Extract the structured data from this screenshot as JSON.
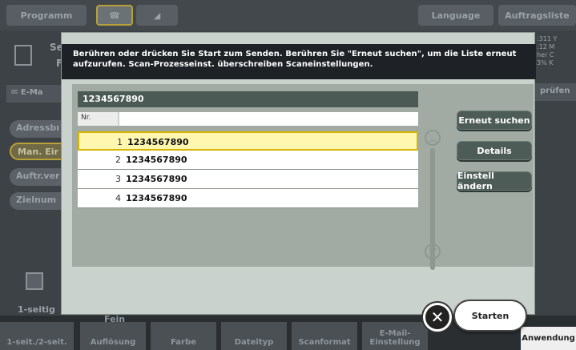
{
  "topbar": {
    "programm": "Programm",
    "language": "Language",
    "auftragsliste": "Auftragsliste"
  },
  "background": {
    "header_line1": "Se",
    "header_line2": "Fa",
    "email_tab": "E-Ma",
    "pills": [
      "Adressbı",
      "Man. Eir",
      "Auftr.ver",
      "Zielnum"
    ],
    "meter_lines": [
      ":311 Y",
      ":12 M",
      "her C",
      "3% K"
    ],
    "pruefen": "prüfen",
    "single_label": "1-seitig"
  },
  "bottom_tabs": {
    "fein": "Fein",
    "tabs": [
      "1-seit./2-seit.",
      "Auflösung",
      "Farbe",
      "Dateityp",
      "Scanformat",
      "E-Mail-\nEinstellung"
    ],
    "anwendung": "Anwendung"
  },
  "modal": {
    "message": "Berühren oder drücken Sie Start zum Senden. Berühren Sie \"Erneut suchen\", um die Liste erneut aufzurufen. Scan-Prozesseinst. überschreiben Scaneinstellungen.",
    "list_title": "1234567890",
    "col_nr": "Nr.",
    "rows": [
      {
        "nr": "1",
        "number": "1234567890",
        "selected": true
      },
      {
        "nr": "2",
        "number": "1234567890",
        "selected": false
      },
      {
        "nr": "3",
        "number": "1234567890",
        "selected": false
      },
      {
        "nr": "4",
        "number": "1234567890",
        "selected": false
      }
    ],
    "buttons": {
      "erneut": "Erneut suchen",
      "details": "Details",
      "einstell": "Einstell ändern"
    }
  },
  "actions": {
    "start": "Starten",
    "cancel_icon": "close-icon"
  },
  "colors": {
    "accent_selected": "#d6b400",
    "button_dark": "#4e5c57",
    "message_bg": "#1e2226"
  }
}
